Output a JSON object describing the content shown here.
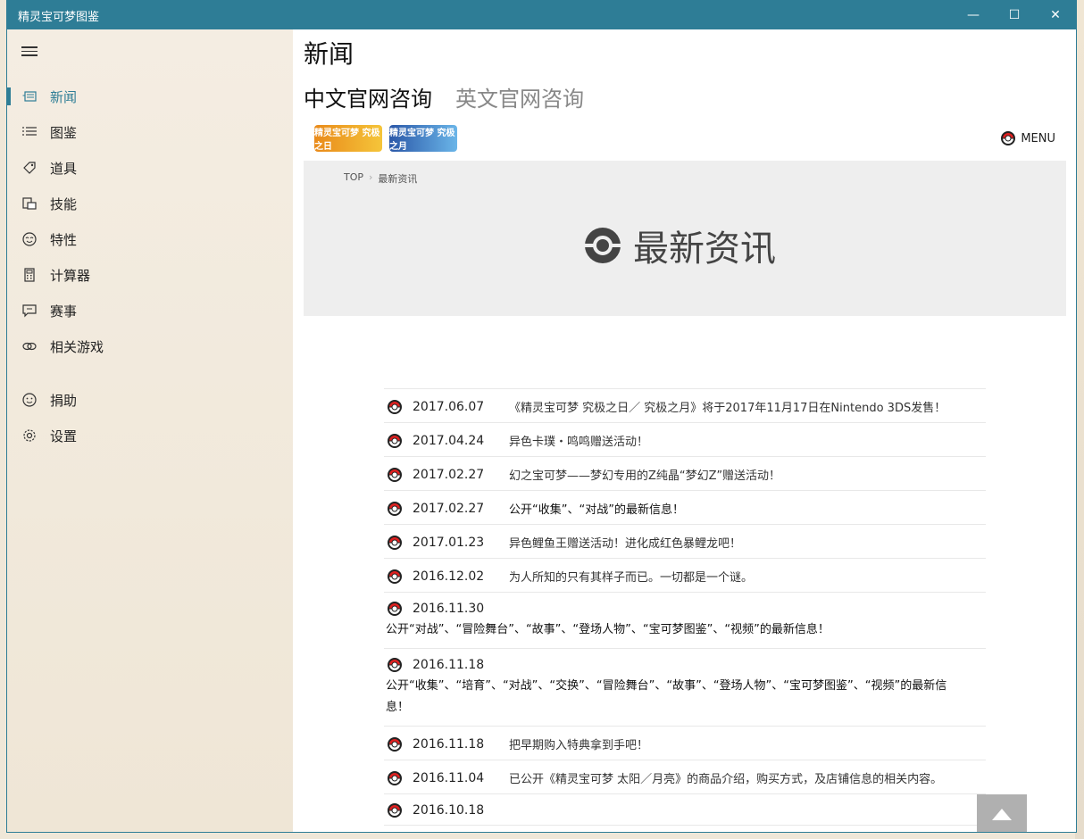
{
  "window": {
    "title": "精灵宝可梦图鉴",
    "controls": {
      "minimize": "—",
      "maximize": "☐",
      "close": "✕"
    }
  },
  "sidebar": {
    "items": [
      {
        "label": "新闻",
        "icon": "news-icon",
        "active": true
      },
      {
        "label": "图鉴",
        "icon": "list-icon"
      },
      {
        "label": "道具",
        "icon": "tag-icon"
      },
      {
        "label": "技能",
        "icon": "skill-icon"
      },
      {
        "label": "特性",
        "icon": "face-icon"
      },
      {
        "label": "计算器",
        "icon": "calculator-icon"
      },
      {
        "label": "赛事",
        "icon": "chat-icon"
      },
      {
        "label": "相关游戏",
        "icon": "link-icon"
      },
      {
        "label": "捐助",
        "icon": "smile-icon"
      },
      {
        "label": "设置",
        "icon": "gear-icon"
      }
    ]
  },
  "main": {
    "page_title": "新闻",
    "tabs": [
      {
        "label": "中文官网咨询",
        "active": true
      },
      {
        "label": "英文官网咨询",
        "active": false
      }
    ],
    "header": {
      "logo_sun": "精灵宝可梦 究极之日",
      "logo_moon": "精灵宝可梦 究极之月",
      "menu_label": "MENU"
    },
    "breadcrumb": {
      "home": "TOP",
      "current": "最新资讯"
    },
    "banner_title": "最新资讯",
    "news": [
      {
        "date": "2017.06.07",
        "text": "《精灵宝可梦 究极之日／ 究极之月》将于2017年11月17日在Nintendo 3DS发售！",
        "layout": "inline"
      },
      {
        "date": "2017.04.24",
        "text": "异色卡璞・鸣鸣赠送活动！",
        "layout": "inline"
      },
      {
        "date": "2017.02.27",
        "text": "幻之宝可梦——梦幻专用的Z纯晶“梦幻Z”赠送活动！",
        "layout": "inline"
      },
      {
        "date": "2017.02.27",
        "text": "公开“收集”、“对战”的最新信息！",
        "layout": "inline"
      },
      {
        "date": "2017.01.23",
        "text": "异色鲤鱼王赠送活动！进化成红色暴鲤龙吧！",
        "layout": "inline"
      },
      {
        "date": "2016.12.02",
        "text": "为人所知的只有其样子而已。一切都是一个谜。",
        "layout": "inline"
      },
      {
        "date": "2016.11.30",
        "text": "公开“对战”、“冒险舞台”、“故事”、“登场人物”、“宝可梦图鉴”、“视频”的最新信息！",
        "layout": "stack"
      },
      {
        "date": "2016.11.18",
        "text": "公开“收集”、“培育”、“对战”、“交换”、“冒险舞台”、“故事”、“登场人物”、“宝可梦图鉴”、“视频”的最新信息！",
        "layout": "stack"
      },
      {
        "date": "2016.11.18",
        "text": "把早期购入特典拿到手吧！",
        "layout": "inline"
      },
      {
        "date": "2016.11.04",
        "text": "已公开《精灵宝可梦 太阳／月亮》的商品介绍，购买方式，及店铺信息的相关内容。",
        "layout": "inline"
      },
      {
        "date": "2016.10.18",
        "text": "",
        "layout": "inline"
      }
    ]
  },
  "colors": {
    "accent": "#2e7d96",
    "pokeball_red": "#e02020"
  }
}
